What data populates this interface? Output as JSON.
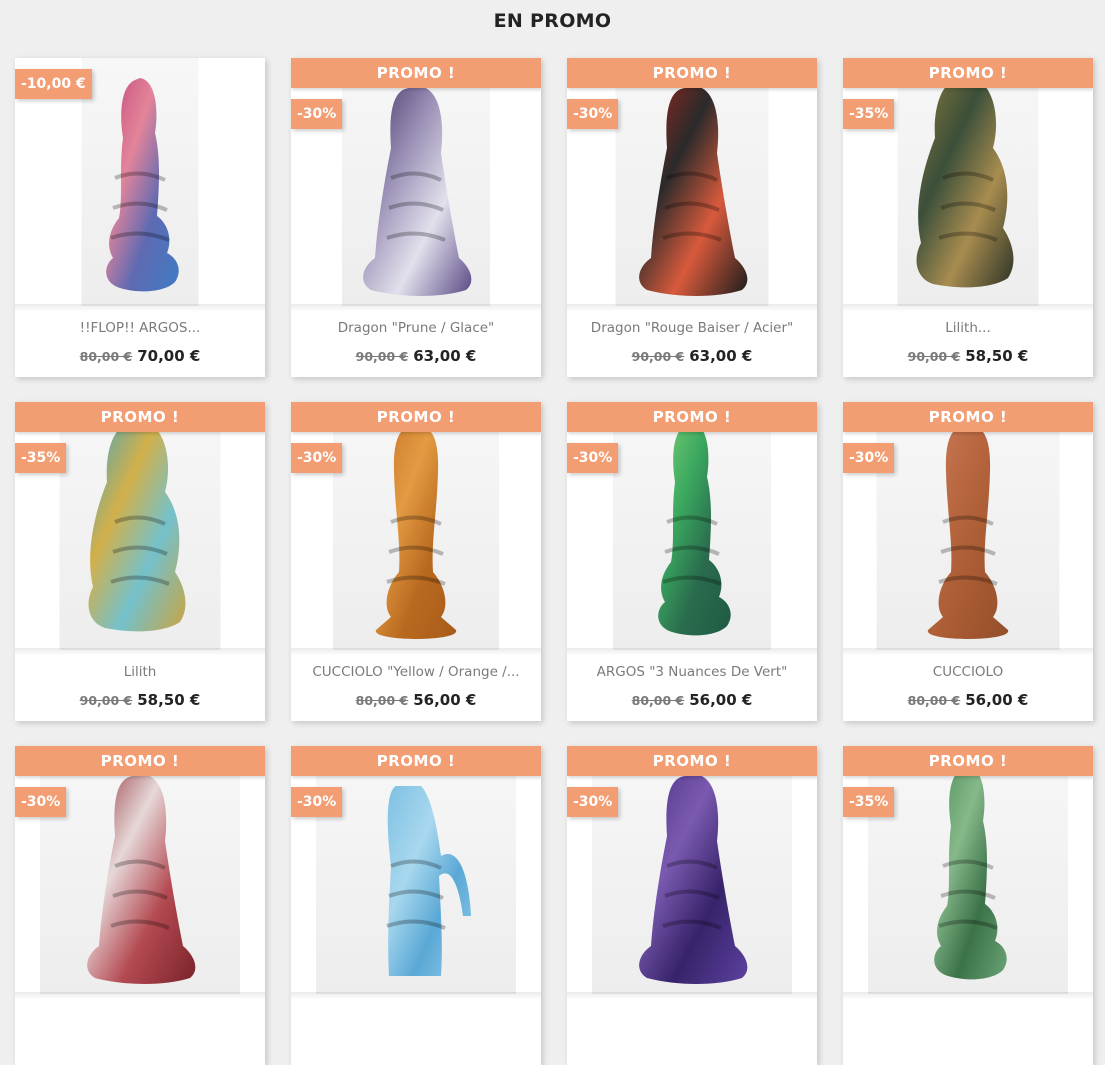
{
  "section": {
    "title": "EN PROMO"
  },
  "products": [
    {
      "flag": "",
      "discount": "-10,00 €",
      "name": "!!FLOP!! ARGOS...",
      "old_price": "80,00 €",
      "price": "70,00 €",
      "colors": [
        "#c04a78",
        "#e4849a",
        "#5e6ab2",
        "#3f7cc4"
      ]
    },
    {
      "flag": "PROMO !",
      "discount": "-30%",
      "name": "Dragon \"Prune / Glace\"",
      "old_price": "90,00 €",
      "price": "63,00 €",
      "colors": [
        "#3d2f63",
        "#9a8fb5",
        "#e2e0ec",
        "#5a4885"
      ]
    },
    {
      "flag": "PROMO !",
      "discount": "-30%",
      "name": "Dragon \"Rouge Baiser / Acier\"",
      "old_price": "90,00 €",
      "price": "63,00 €",
      "colors": [
        "#a5281f",
        "#2a2a2a",
        "#d85a3c",
        "#1c1c1c"
      ]
    },
    {
      "flag": "PROMO !",
      "discount": "-35%",
      "name": "Lilith...",
      "old_price": "90,00 €",
      "price": "58,50 €",
      "colors": [
        "#8a7a3a",
        "#3b4f3a",
        "#a88c4f",
        "#2c3327"
      ]
    },
    {
      "flag": "PROMO !",
      "discount": "-35%",
      "name": "Lilith",
      "old_price": "90,00 €",
      "price": "58,50 €",
      "colors": [
        "#3fa5c4",
        "#d2b04a",
        "#74c1cc",
        "#c9a440"
      ]
    },
    {
      "flag": "PROMO !",
      "discount": "-30%",
      "name": "CUCCIOLO \"Yellow / Orange /...",
      "old_price": "80,00 €",
      "price": "56,00 €",
      "colors": [
        "#c7742a",
        "#e39a42",
        "#b9691f",
        "#a85c1a"
      ]
    },
    {
      "flag": "PROMO !",
      "discount": "-30%",
      "name": "ARGOS \"3 Nuances De Vert\"",
      "old_price": "80,00 €",
      "price": "56,00 €",
      "colors": [
        "#7fcf76",
        "#3aa85f",
        "#2a6b4d",
        "#1f5a43"
      ]
    },
    {
      "flag": "PROMO !",
      "discount": "-30%",
      "name": "CUCCIOLO",
      "old_price": "80,00 €",
      "price": "56,00 €",
      "colors": [
        "#c97a58",
        "#b8673f",
        "#a85a32",
        "#93502c"
      ]
    },
    {
      "flag": "PROMO !",
      "discount": "-30%",
      "name": "",
      "old_price": "",
      "price": "",
      "colors": [
        "#8e2b33",
        "#e6d8d8",
        "#b44a52",
        "#7a2229"
      ]
    },
    {
      "flag": "PROMO !",
      "discount": "-30%",
      "name": "",
      "old_price": "",
      "price": "",
      "colors": [
        "#7ec0e2",
        "#a8d8ee",
        "#5aa8d6",
        "#93cce8"
      ]
    },
    {
      "flag": "PROMO !",
      "discount": "-30%",
      "name": "",
      "old_price": "",
      "price": "",
      "colors": [
        "#4a2f83",
        "#7a5ab0",
        "#37236a",
        "#5c42a0"
      ]
    },
    {
      "flag": "PROMO !",
      "discount": "-35%",
      "name": "",
      "old_price": "",
      "price": "",
      "colors": [
        "#4f8f5a",
        "#86b88a",
        "#3b7248",
        "#6aa376"
      ]
    }
  ]
}
